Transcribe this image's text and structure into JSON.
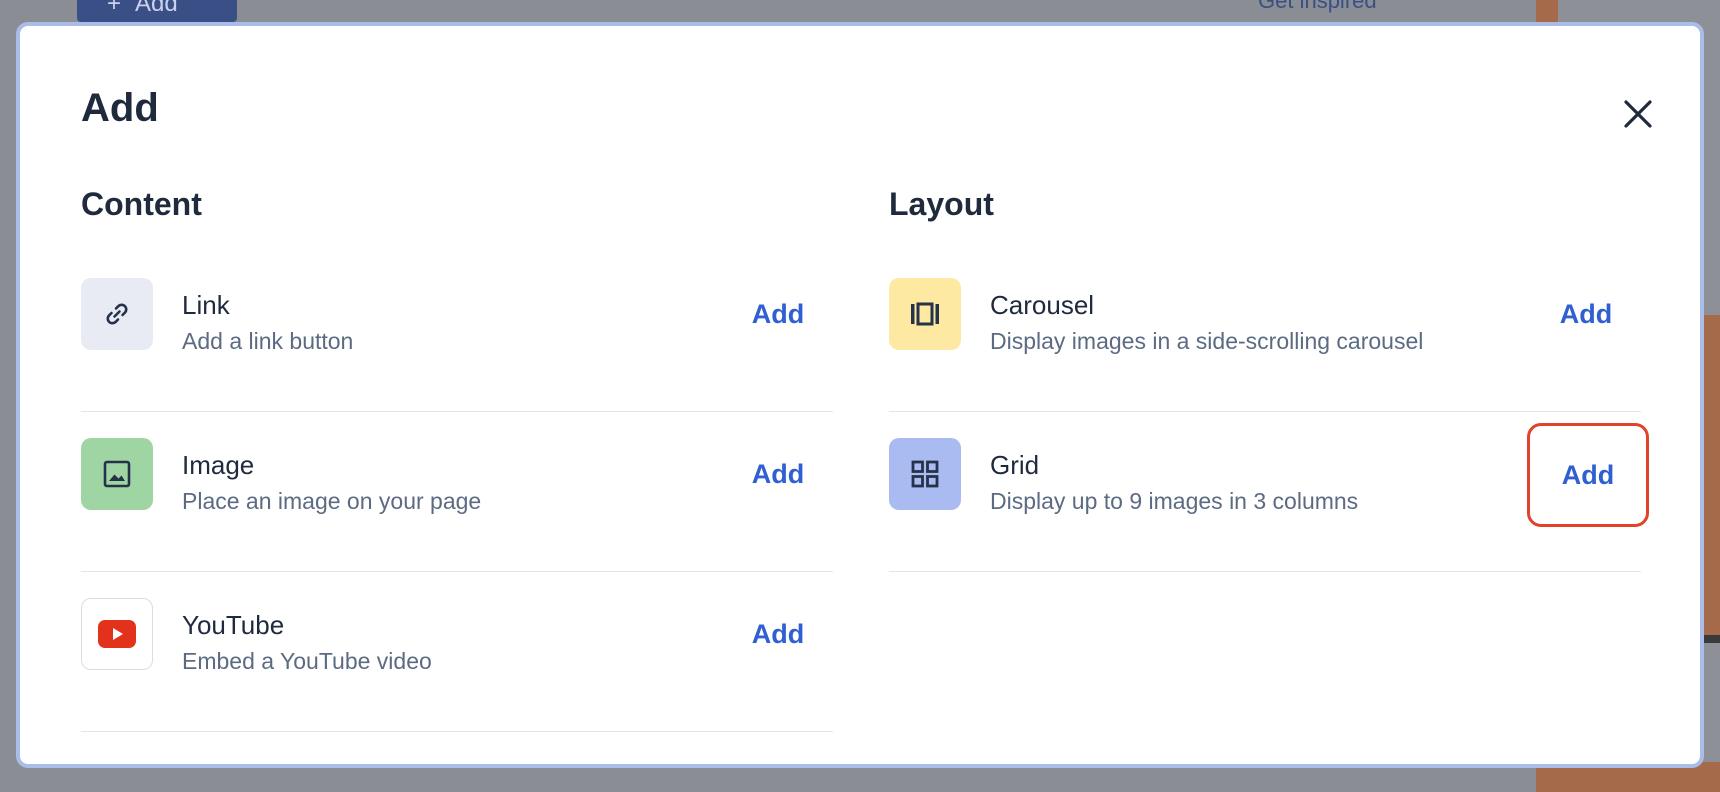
{
  "background": {
    "top_add_label": "Add",
    "get_inspired_label": "Get inspired"
  },
  "modal": {
    "title": "Add",
    "close_icon": "close-icon",
    "content": {
      "title": "Content",
      "items": [
        {
          "name": "Link",
          "description": "Add a link button",
          "action": "Add",
          "icon": "link-icon"
        },
        {
          "name": "Image",
          "description": "Place an image on your page",
          "action": "Add",
          "icon": "image-icon"
        },
        {
          "name": "YouTube",
          "description": "Embed a YouTube video",
          "action": "Add",
          "icon": "youtube-icon"
        }
      ]
    },
    "layout": {
      "title": "Layout",
      "items": [
        {
          "name": "Carousel",
          "description": "Display images in a side-scrolling carousel",
          "action": "Add",
          "icon": "carousel-icon"
        },
        {
          "name": "Grid",
          "description": "Display up to 9 images in 3 columns",
          "action": "Add",
          "icon": "grid-icon"
        }
      ]
    }
  },
  "colors": {
    "accent": "#2f5fd0",
    "focus_ring": "#e0422a",
    "youtube_red": "#e3321b"
  }
}
